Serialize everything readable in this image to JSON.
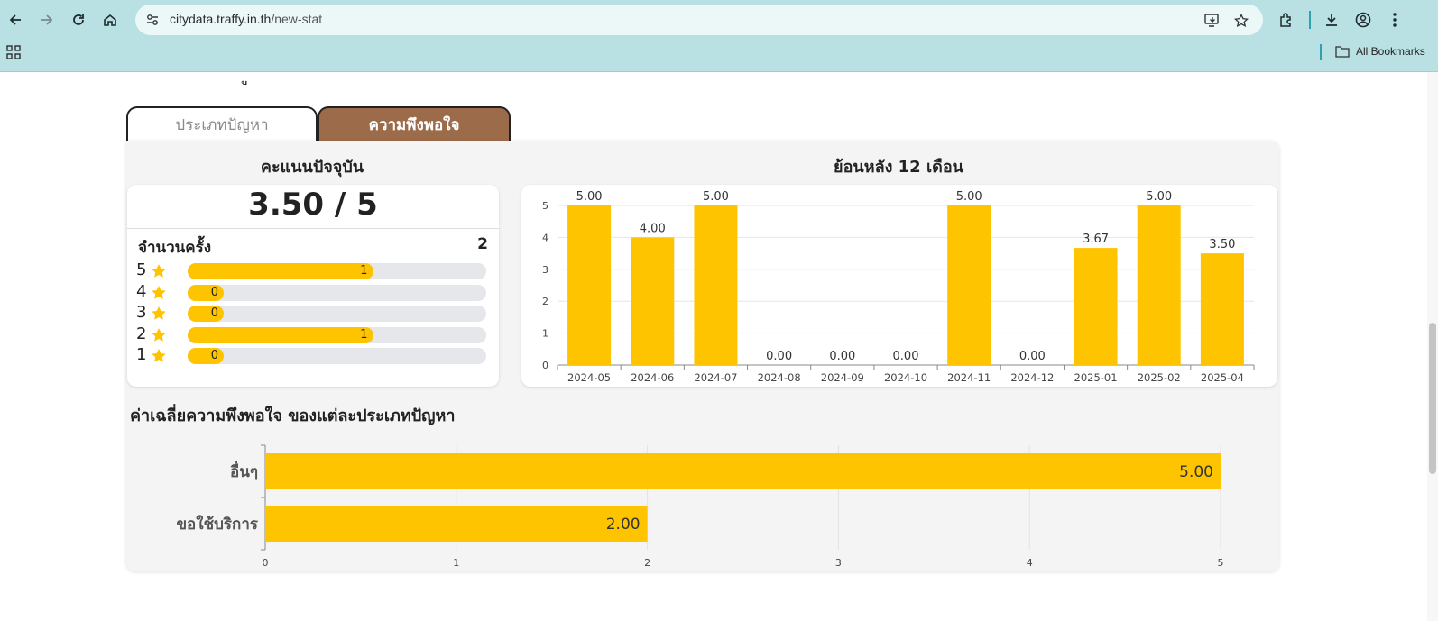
{
  "browser": {
    "url_host": "citydata.traffy.in.th",
    "url_path": "/new-stat",
    "bookmarks_label": "All Bookmarks"
  },
  "tabs": [
    {
      "label": "ประเภทปัญหา",
      "active": false
    },
    {
      "label": "ความพึงพอใจ",
      "active": true
    }
  ],
  "current": {
    "title": "คะแนนปัจจุบัน",
    "score": "3.50 / 5",
    "count_label": "จำนวนครั้ง",
    "count_value": "2",
    "stars": [
      {
        "star": "5",
        "count": "1",
        "fraction": 0.5
      },
      {
        "star": "4",
        "count": "0",
        "fraction": 0
      },
      {
        "star": "3",
        "count": "0",
        "fraction": 0
      },
      {
        "star": "2",
        "count": "1",
        "fraction": 0.5
      },
      {
        "star": "1",
        "count": "0",
        "fraction": 0
      }
    ]
  },
  "history": {
    "title": "ย้อนหลัง 12 เดือน"
  },
  "average": {
    "title": "ค่าเฉลี่ยความพึงพอใจ ของแต่ละประเภทปัญหา"
  },
  "colors": {
    "bar": "#ffc400",
    "active_tab": "#9c6c4a",
    "panel": "#f4f4f4"
  },
  "chart_data": [
    {
      "type": "bar",
      "categories": [
        "2024-05",
        "2024-06",
        "2024-07",
        "2024-08",
        "2024-09",
        "2024-10",
        "2024-11",
        "2024-12",
        "2025-01",
        "2025-02",
        "2025-04"
      ],
      "values": [
        5.0,
        4.0,
        5.0,
        0.0,
        0.0,
        0.0,
        5.0,
        0.0,
        3.67,
        5.0,
        3.5
      ],
      "data_labels": [
        "5.00",
        "4.00",
        "5.00",
        "0.00",
        "0.00",
        "0.00",
        "5.00",
        "0.00",
        "3.67",
        "5.00",
        "3.50"
      ],
      "yticks": [
        "0",
        "1",
        "2",
        "3",
        "4",
        "5"
      ],
      "ylim": [
        0,
        5
      ],
      "grid": true
    },
    {
      "type": "bar",
      "orientation": "horizontal",
      "categories": [
        "อื่นๆ",
        "ขอใช้บริการ"
      ],
      "values": [
        5.0,
        2.0
      ],
      "data_labels": [
        "5.00",
        "2.00"
      ],
      "xticks": [
        "0",
        "1",
        "2",
        "3",
        "4",
        "5"
      ],
      "xlim": [
        0,
        5
      ],
      "grid": true
    }
  ]
}
